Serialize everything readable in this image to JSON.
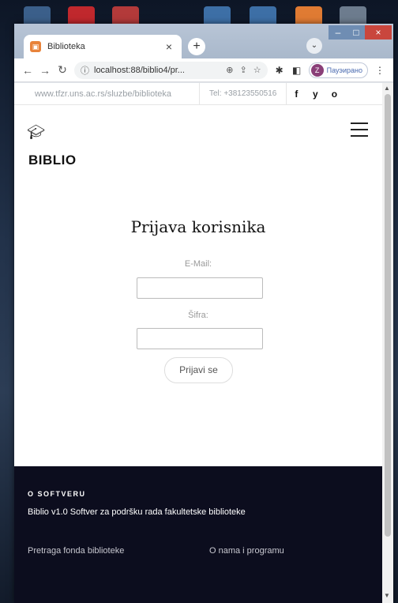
{
  "browser": {
    "tab_title": "Biblioteka",
    "tab_close": "×",
    "new_tab": "+",
    "address": "localhost:88/biblio4/pr...",
    "profile_initial": "Z",
    "profile_label": "Пауэирано"
  },
  "site": {
    "topbar_link": "www.tfzr.uns.ac.rs/sluzbe/biblioteka",
    "phone": "Tel: +38123550516",
    "social": [
      "f",
      "y",
      "o"
    ],
    "brand": "BIBLIO"
  },
  "login": {
    "title": "Prijava korisnika",
    "email_label": "E-Mail:",
    "email_value": "",
    "password_label": "Šifra:",
    "password_value": "",
    "submit_label": "Prijavi se"
  },
  "footer": {
    "heading": "O SOFTVERU",
    "description": "Biblio v1.0 Softver za podršku rada fakultetske biblioteke",
    "links": [
      "Pretraga fonda biblioteke",
      "O nama i programu"
    ]
  }
}
